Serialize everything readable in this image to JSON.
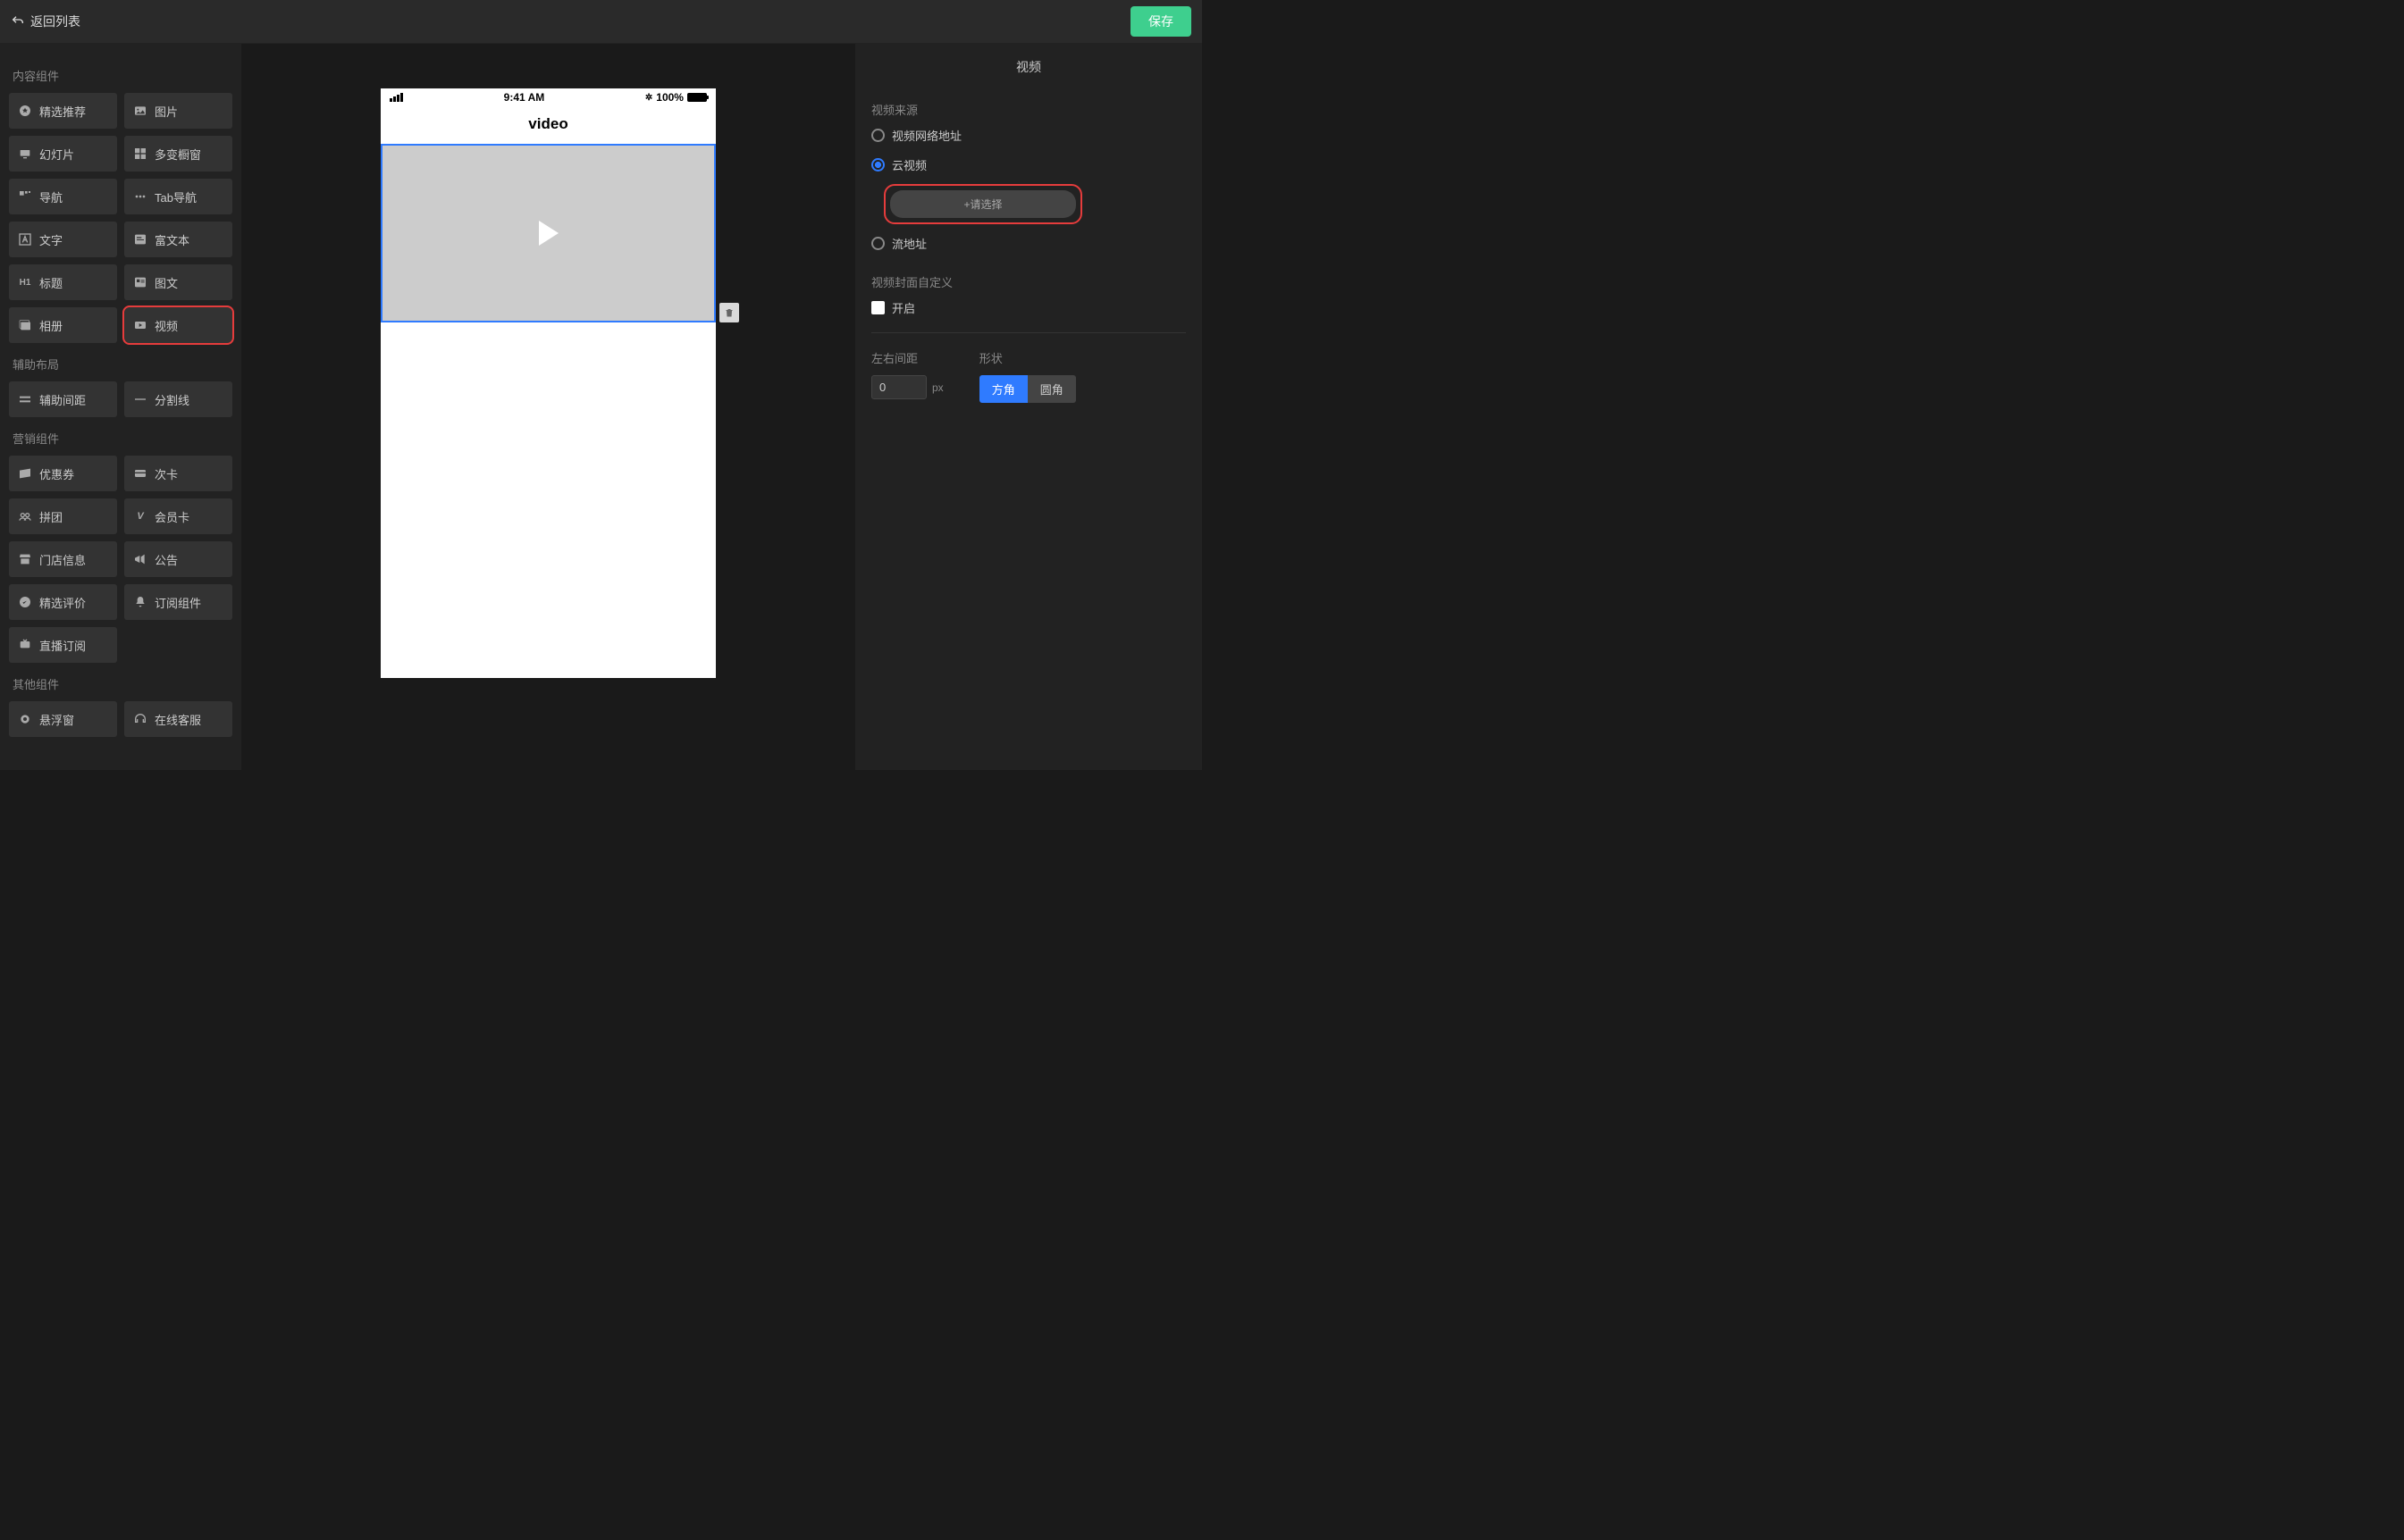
{
  "header": {
    "back_label": "返回列表",
    "save_label": "保存"
  },
  "left": {
    "sections": [
      {
        "title": "内容组件",
        "items": [
          {
            "label": "精选推荐",
            "icon": "star-badge-icon"
          },
          {
            "label": "图片",
            "icon": "image-icon"
          },
          {
            "label": "幻灯片",
            "icon": "slideshow-icon"
          },
          {
            "label": "多变橱窗",
            "icon": "grid-icon"
          },
          {
            "label": "导航",
            "icon": "nav-icon"
          },
          {
            "label": "Tab导航",
            "icon": "dots-icon"
          },
          {
            "label": "文字",
            "icon": "text-a-icon"
          },
          {
            "label": "富文本",
            "icon": "richtext-icon"
          },
          {
            "label": "标题",
            "icon": "heading-icon"
          },
          {
            "label": "图文",
            "icon": "image-text-icon"
          },
          {
            "label": "相册",
            "icon": "album-icon"
          },
          {
            "label": "视频",
            "icon": "video-icon",
            "highlight": true
          }
        ]
      },
      {
        "title": "辅助布局",
        "items": [
          {
            "label": "辅助间距",
            "icon": "spacer-icon"
          },
          {
            "label": "分割线",
            "icon": "line-icon"
          }
        ]
      },
      {
        "title": "营销组件",
        "items": [
          {
            "label": "优惠券",
            "icon": "coupon-icon"
          },
          {
            "label": "次卡",
            "icon": "card-icon"
          },
          {
            "label": "拼团",
            "icon": "group-icon"
          },
          {
            "label": "会员卡",
            "icon": "vip-icon"
          },
          {
            "label": "门店信息",
            "icon": "store-icon"
          },
          {
            "label": "公告",
            "icon": "megaphone-icon"
          },
          {
            "label": "精选评价",
            "icon": "review-icon"
          },
          {
            "label": "订阅组件",
            "icon": "bell-icon"
          },
          {
            "label": "直播订阅",
            "icon": "live-icon"
          }
        ]
      },
      {
        "title": "其他组件",
        "items": [
          {
            "label": "悬浮窗",
            "icon": "float-icon"
          },
          {
            "label": "在线客服",
            "icon": "service-icon"
          }
        ]
      }
    ]
  },
  "canvas": {
    "status_time": "9:41 AM",
    "status_battery": "100%",
    "bluetooth_glyph": "✱",
    "page_title": "video"
  },
  "right": {
    "panel_title": "视频",
    "source_label": "视频来源",
    "source_options": {
      "url": "视频网络地址",
      "cloud": "云视频",
      "stream": "流地址"
    },
    "source_selected": "cloud",
    "select_button": "+请选择",
    "cover_label": "视频封面自定义",
    "cover_enable": "开启",
    "margin_label": "左右间距",
    "margin_value": "0",
    "margin_unit": "px",
    "shape_label": "形状",
    "shape_options": {
      "square": "方角",
      "round": "圆角"
    },
    "shape_selected": "square"
  }
}
